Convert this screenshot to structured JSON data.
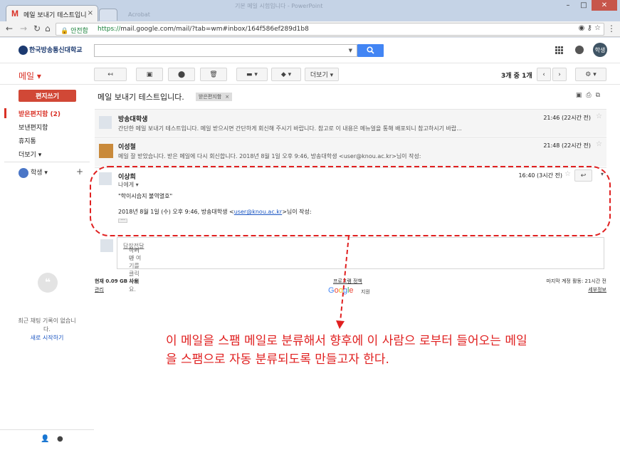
{
  "browser": {
    "tab_title": "메일 보내기 테스트입니다",
    "ghost_title": "기본 메일 시험입니다 - PowerPoint",
    "ghost_user": "Acrobat",
    "secure_label": "안전함",
    "url_scheme": "https://",
    "url_rest": "mail.google.com/mail/?tab=wm#inbox/164f586ef289d1b8"
  },
  "header": {
    "logo_text": "한국방송통신대학교",
    "avatar_label": "학생"
  },
  "actions": {
    "mail_label": "메일 ▾",
    "more_label": "더보기 ▾",
    "count_current": "3개 중 1개"
  },
  "sidebar": {
    "compose_label": "편지쓰기",
    "items": [
      {
        "label": "받은편지함 (2)"
      },
      {
        "label": "보낸편지함"
      },
      {
        "label": "휴지통"
      },
      {
        "label": "더보기 ▾"
      }
    ],
    "hangout_user": "학생",
    "hangout_empty": "최근 채팅 기록이 없습니\n다.",
    "hangout_start": "새로 시작하기"
  },
  "thread": {
    "subject": "메일 보내기 테스트입니다.",
    "tag": "받은편지함",
    "messages": [
      {
        "sender": "방송대학생",
        "snippet": "간단한 메일 보내기 테스트입니다. 메일 받으시면 간단하게 회신해 주시기 바랍니다. 참고로 이 내용은 메뉴얼을 통해 배포되니 참고하시기 바랍...",
        "time": "21:46 (22시간 전)"
      },
      {
        "sender": "이성철",
        "snippet": "메일 잘 받았습니다. 받은 메일에 다시 회신합니다. 2018년 8월 1일 오후 9:46, 방송대학생 <user@knou.ac.kr>님이 작성:",
        "time": "21:48 (22시간 전)"
      }
    ],
    "open": {
      "sender": "이상희",
      "to": "나에게 ▾",
      "quote": "\"학이시습지 불역열호\"",
      "line_prefix": "2018년 8월 1일 (수) 오후 9:46, 방송대학생 <",
      "line_email": "user@knou.ac.kr",
      "line_suffix": ">님이 작성:",
      "time": "16:40 (3시간 전)"
    },
    "reply_prompt_a": "답장",
    "reply_prompt_b": "하거나 ",
    "reply_prompt_c": "전달",
    "reply_prompt_d": "하려면 여기를 클릭하세요."
  },
  "footer": {
    "usage": "현재 0.09 GB 사용",
    "manage": "관리",
    "privacy": "프로그램 정책",
    "support": "지원",
    "last_activity": "마지막 계정 활동: 21시간 전",
    "details": "세부정보"
  },
  "annotation": {
    "text": "이 메일을 스팸 메일로 분류해서 향후에 이 사람으  로부터 들어오는 메일을 스팸으로 자동 분류되도록   만들고자  한다.",
    "color": "#e02020"
  }
}
